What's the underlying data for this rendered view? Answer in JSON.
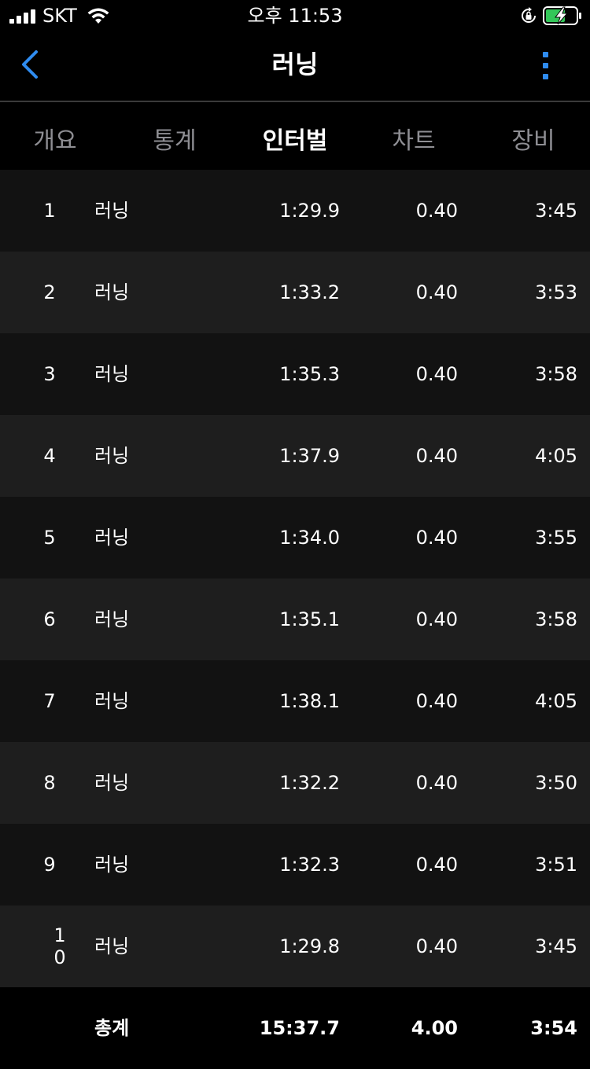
{
  "status_bar": {
    "carrier": "SKT",
    "time": "오후 11:53"
  },
  "nav": {
    "title": "러닝"
  },
  "tabs": [
    {
      "label": "개요",
      "active": false
    },
    {
      "label": "통계",
      "active": false
    },
    {
      "label": "인터벌",
      "active": true
    },
    {
      "label": "차트",
      "active": false
    },
    {
      "label": "장비",
      "active": false
    }
  ],
  "intervals": [
    {
      "num": "1",
      "type": "러닝",
      "time": "1:29.9",
      "distance": "0.40",
      "pace": "3:45"
    },
    {
      "num": "2",
      "type": "러닝",
      "time": "1:33.2",
      "distance": "0.40",
      "pace": "3:53"
    },
    {
      "num": "3",
      "type": "러닝",
      "time": "1:35.3",
      "distance": "0.40",
      "pace": "3:58"
    },
    {
      "num": "4",
      "type": "러닝",
      "time": "1:37.9",
      "distance": "0.40",
      "pace": "4:05"
    },
    {
      "num": "5",
      "type": "러닝",
      "time": "1:34.0",
      "distance": "0.40",
      "pace": "3:55"
    },
    {
      "num": "6",
      "type": "러닝",
      "time": "1:35.1",
      "distance": "0.40",
      "pace": "3:58"
    },
    {
      "num": "7",
      "type": "러닝",
      "time": "1:38.1",
      "distance": "0.40",
      "pace": "4:05"
    },
    {
      "num": "8",
      "type": "러닝",
      "time": "1:32.2",
      "distance": "0.40",
      "pace": "3:50"
    },
    {
      "num": "9",
      "type": "러닝",
      "time": "1:32.3",
      "distance": "0.40",
      "pace": "3:51"
    },
    {
      "num": "10",
      "type": "러닝",
      "time": "1:29.8",
      "distance": "0.40",
      "pace": "3:45"
    }
  ],
  "total": {
    "label": "총계",
    "time": "15:37.7",
    "distance": "4.00",
    "pace": "3:54"
  },
  "colors": {
    "accent": "#2f8cf0",
    "battery_charge": "#34c759"
  }
}
